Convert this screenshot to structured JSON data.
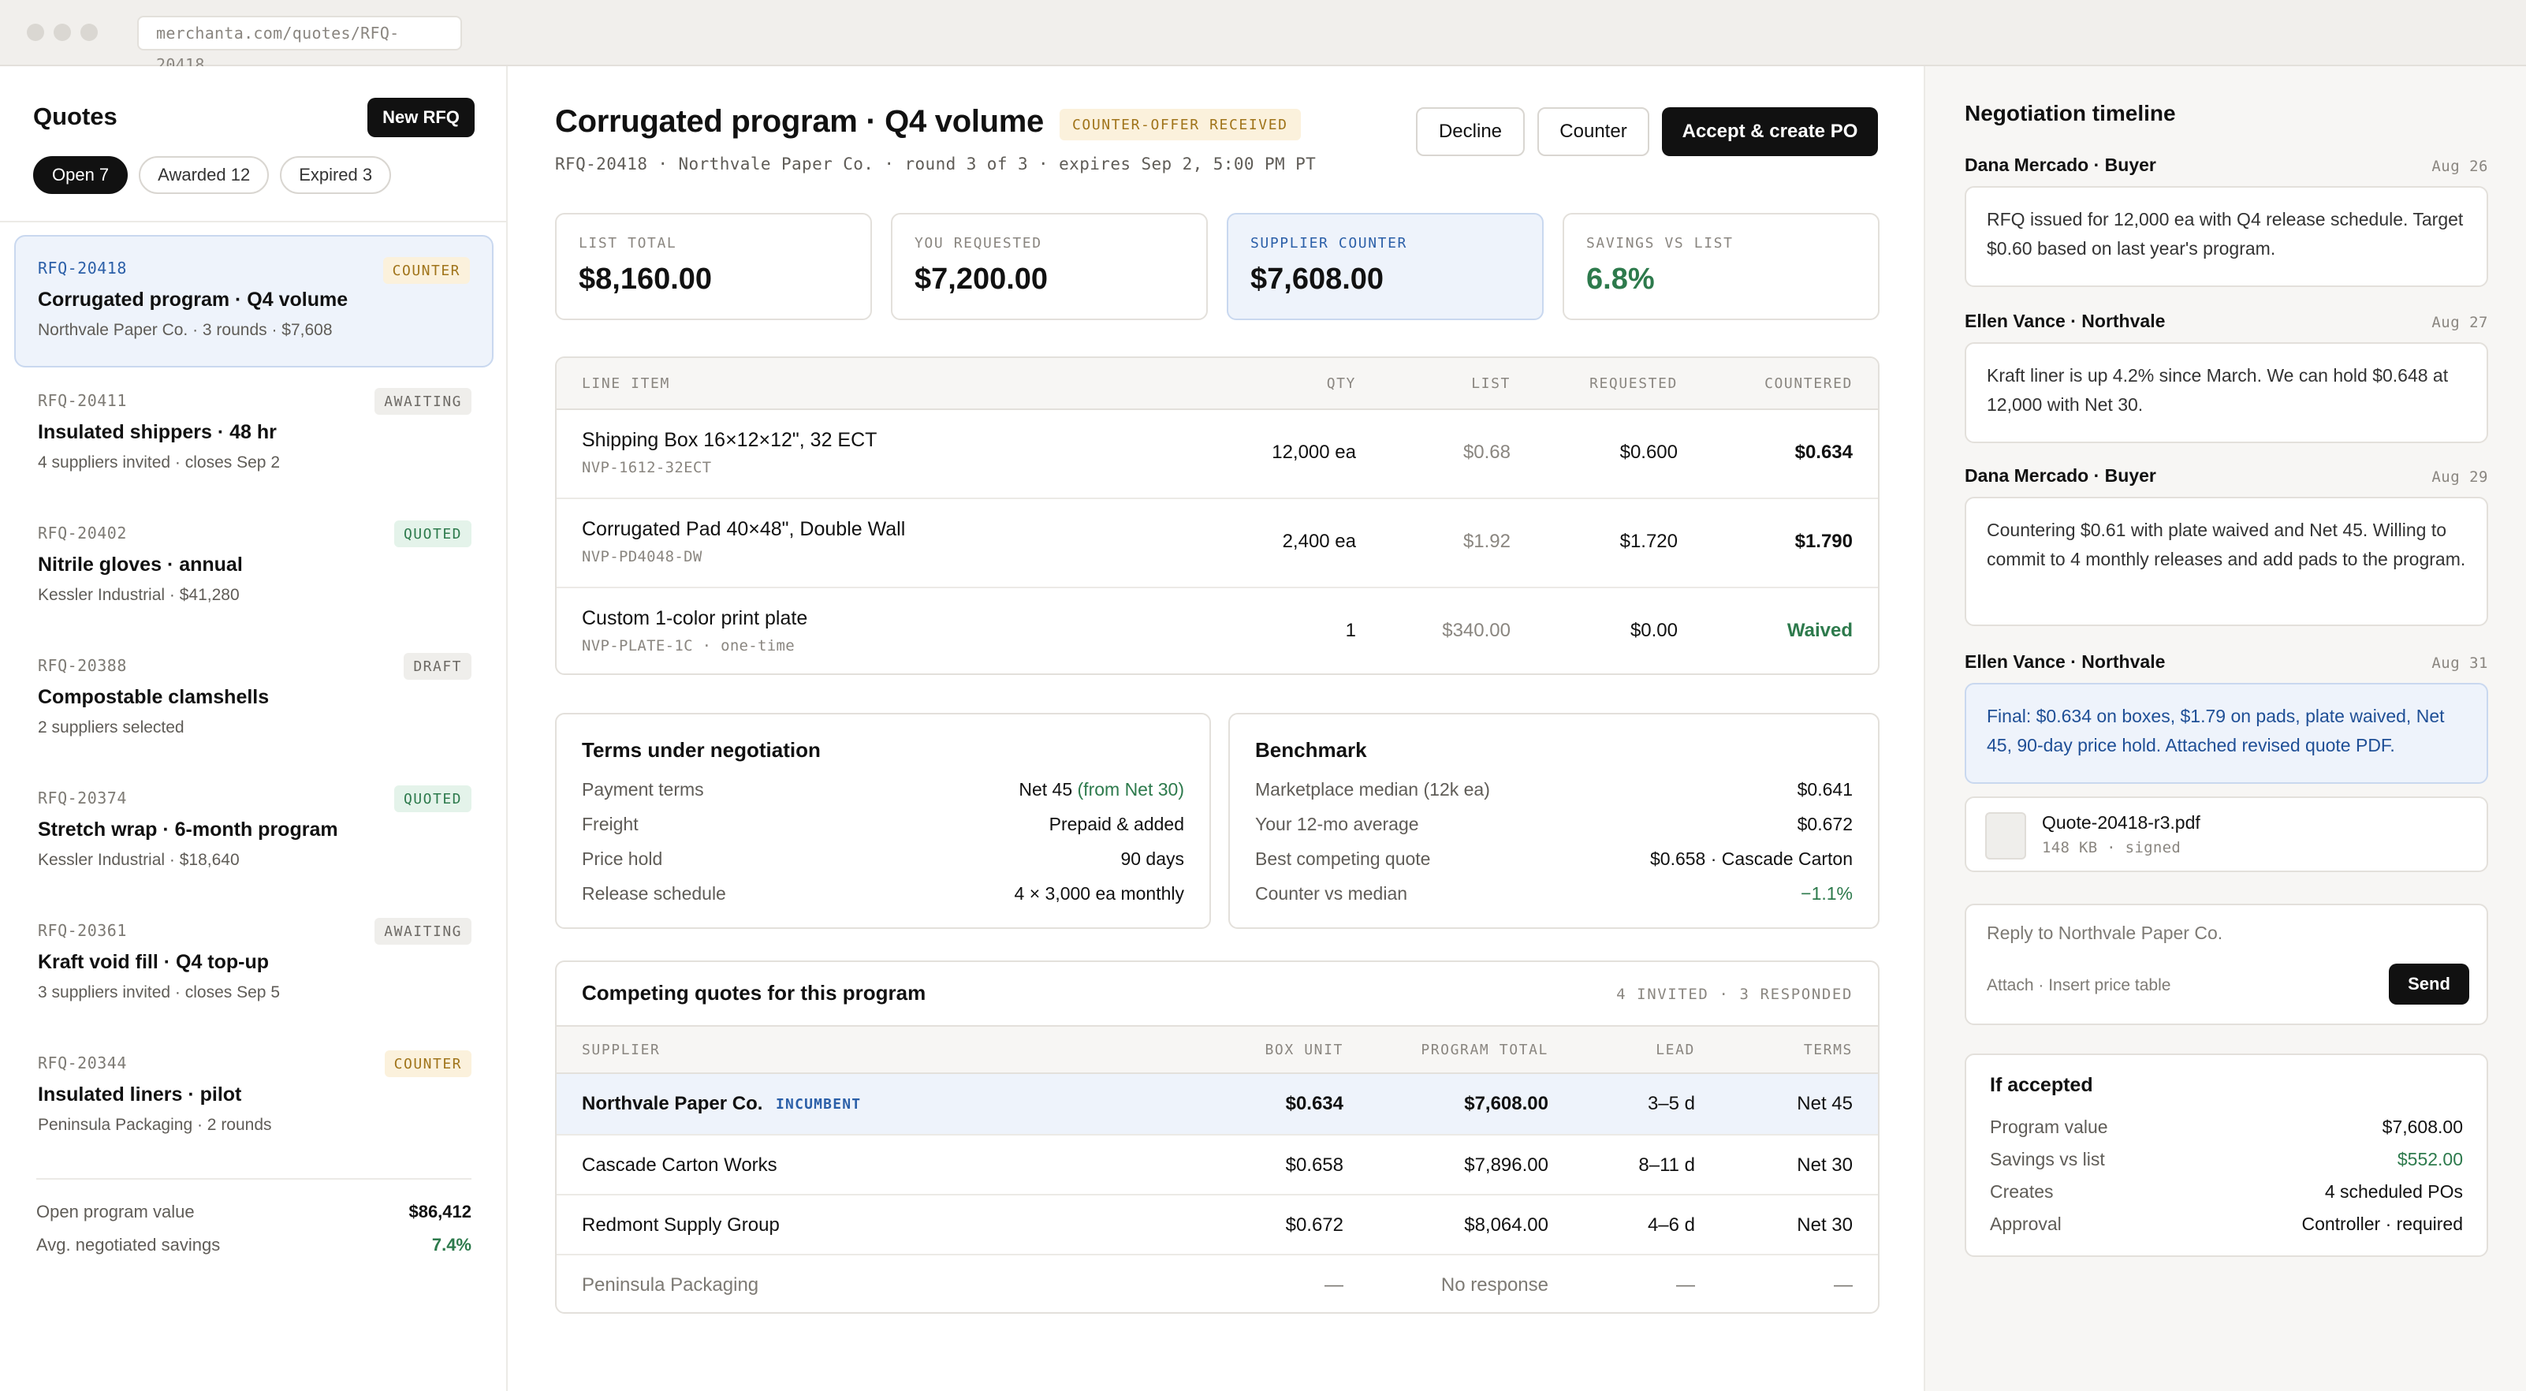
{
  "browser": {
    "url": "merchanta.com/quotes/RFQ-20418"
  },
  "sidebar": {
    "title": "Quotes",
    "new_button": "New RFQ",
    "filters": [
      {
        "label": "Open 7",
        "active": true
      },
      {
        "label": "Awarded 12",
        "active": false
      },
      {
        "label": "Expired 3",
        "active": false
      }
    ],
    "quotes": [
      {
        "id": "RFQ-20418",
        "title": "Corrugated program · Q4 volume",
        "meta": "Northvale Paper Co. · 3 rounds · $7,608",
        "status": "COUNTER",
        "status_kind": "counter",
        "selected": true
      },
      {
        "id": "RFQ-20411",
        "title": "Insulated shippers · 48 hr",
        "meta": "4 suppliers invited · closes Sep 2",
        "status": "AWAITING",
        "status_kind": "awaiting",
        "selected": false
      },
      {
        "id": "RFQ-20402",
        "title": "Nitrile gloves · annual",
        "meta": "Kessler Industrial · $41,280",
        "status": "QUOTED",
        "status_kind": "quoted",
        "selected": false
      },
      {
        "id": "RFQ-20388",
        "title": "Compostable clamshells",
        "meta": "2 suppliers selected",
        "status": "DRAFT",
        "status_kind": "draft",
        "selected": false
      },
      {
        "id": "RFQ-20374",
        "title": "Stretch wrap · 6-month program",
        "meta": "Kessler Industrial · $18,640",
        "status": "QUOTED",
        "status_kind": "quoted",
        "selected": false
      },
      {
        "id": "RFQ-20361",
        "title": "Kraft void fill · Q4 top-up",
        "meta": "3 suppliers invited · closes Sep 5",
        "status": "AWAITING",
        "status_kind": "awaiting",
        "selected": false
      },
      {
        "id": "RFQ-20344",
        "title": "Insulated liners · pilot",
        "meta": "Peninsula Packaging · 2 rounds",
        "status": "COUNTER",
        "status_kind": "counter",
        "selected": false
      }
    ],
    "summary": [
      {
        "label": "Open program value",
        "value": "$86,412"
      },
      {
        "label": "Avg. negotiated savings",
        "value": "7.4%"
      }
    ]
  },
  "detail": {
    "title": "Corrugated program · Q4 volume",
    "status_badge": "COUNTER-OFFER RECEIVED",
    "subtitle": "RFQ-20418 · Northvale Paper Co. · round 3 of 3 · expires Sep 2, 5:00 PM PT",
    "actions": {
      "decline": "Decline",
      "counter": "Counter",
      "accept": "Accept & create PO"
    },
    "stats": [
      {
        "label": "LIST TOTAL",
        "value": "$8,160.00"
      },
      {
        "label": "YOU REQUESTED",
        "value": "$7,200.00"
      },
      {
        "label": "SUPPLIER COUNTER",
        "value": "$7,608.00"
      },
      {
        "label": "SAVINGS VS LIST",
        "value": "6.8%"
      }
    ],
    "line_items": {
      "headers": [
        "LINE ITEM",
        "QTY",
        "LIST",
        "REQUESTED",
        "COUNTERED"
      ],
      "rows": [
        {
          "name": "Shipping Box 16×12×12\", 32 ECT",
          "sku": "NVP-1612-32ECT",
          "qty": "12,000 ea",
          "list": "$0.68",
          "requested": "$0.600",
          "countered": "$0.634"
        },
        {
          "name": "Corrugated Pad 40×48\", Double Wall",
          "sku": "NVP-PD4048-DW",
          "qty": "2,400 ea",
          "list": "$1.92",
          "requested": "$1.720",
          "countered": "$1.790"
        },
        {
          "name": "Custom 1-color print plate",
          "sku": "NVP-PLATE-1C · one-time",
          "qty": "1",
          "list": "$340.00",
          "requested": "$0.00",
          "countered": "Waived"
        }
      ]
    },
    "terms": {
      "title": "Terms under negotiation",
      "payment_label": "Payment terms",
      "payment_value": "Net 45",
      "payment_note": "(from Net 30)",
      "rows": [
        {
          "label": "Freight",
          "value": "Prepaid & added"
        },
        {
          "label": "Price hold",
          "value": "90 days"
        },
        {
          "label": "Release schedule",
          "value": "4 × 3,000 ea monthly"
        }
      ]
    },
    "benchmark": {
      "title": "Benchmark",
      "rows": [
        {
          "label": "Marketplace median (12k ea)",
          "value": "$0.641"
        },
        {
          "label": "Your 12-mo average",
          "value": "$0.672"
        },
        {
          "label": "Best competing quote",
          "value": "$0.658 · Cascade Carton"
        },
        {
          "label": "Counter vs median",
          "value": "−1.1%"
        }
      ]
    },
    "competing": {
      "title": "Competing quotes for this program",
      "meta": "4 INVITED · 3 RESPONDED",
      "headers": [
        "SUPPLIER",
        "BOX UNIT",
        "PROGRAM TOTAL",
        "LEAD",
        "TERMS"
      ],
      "incumbent_tag": "INCUMBENT",
      "rows": [
        {
          "supplier": "Northvale Paper Co.",
          "box_unit": "$0.634",
          "total": "$7,608.00",
          "lead": "3–5 d",
          "terms": "Net 45"
        },
        {
          "supplier": "Cascade Carton Works",
          "box_unit": "$0.658",
          "total": "$7,896.00",
          "lead": "8–11 d",
          "terms": "Net 30"
        },
        {
          "supplier": "Redmont Supply Group",
          "box_unit": "$0.672",
          "total": "$8,064.00",
          "lead": "4–6 d",
          "terms": "Net 30"
        },
        {
          "supplier": "Peninsula Packaging",
          "box_unit": "—",
          "total": "No response",
          "lead": "—",
          "terms": "—"
        }
      ]
    }
  },
  "timeline": {
    "title": "Negotiation timeline",
    "entries": [
      {
        "author": "Dana Mercado · Buyer",
        "date": "Aug 26",
        "message": "RFQ issued for 12,000 ea with Q4 release schedule. Target $0.60 based on last year's program."
      },
      {
        "author": "Ellen Vance · Northvale",
        "date": "Aug 27",
        "message": "Kraft liner is up 4.2% since March. We can hold $0.648 at 12,000 with Net 30."
      },
      {
        "author": "Dana Mercado · Buyer",
        "date": "Aug 29",
        "message": "Countering $0.61 with plate waived and Net 45. Willing to commit to 4 monthly releases and add pads to the program."
      },
      {
        "author": "Ellen Vance · Northvale",
        "date": "Aug 31",
        "message": "Final: $0.634 on boxes, $1.79 on pads, plate waived, Net 45, 90-day price hold. Attached revised quote PDF."
      }
    ],
    "attachment": {
      "name": "Quote-20418-r3.pdf",
      "meta": "148 KB · signed"
    },
    "reply": {
      "placeholder": "Reply to Northvale Paper Co.",
      "tools": "Attach · Insert price table",
      "send": "Send"
    },
    "if_accepted": {
      "title": "If accepted",
      "rows": [
        {
          "label": "Program value",
          "value": "$7,608.00"
        },
        {
          "label": "Savings vs list",
          "value": "$552.00"
        },
        {
          "label": "Creates",
          "value": "4 scheduled POs"
        },
        {
          "label": "Approval",
          "value": "Controller · required"
        }
      ]
    }
  },
  "colors": {
    "accent_blue": "#2b5fa8",
    "positive_green": "#2d7a4c",
    "counter_amber": "#a0741a",
    "dark_button": "#111111"
  }
}
